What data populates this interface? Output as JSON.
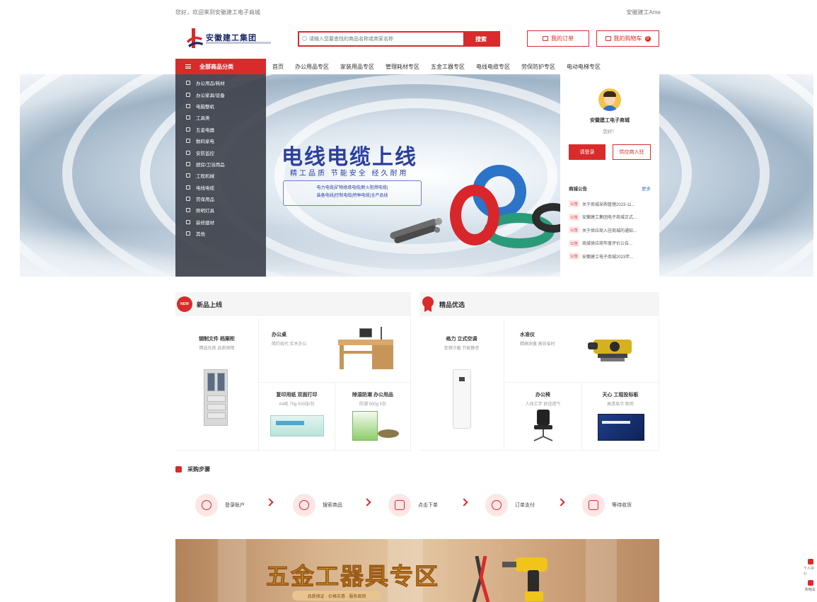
{
  "topbar": {
    "welcome": "您好，欢迎来到安徽建工电子商城",
    "right_link": "安徽建工Ame"
  },
  "brand": {
    "name": "安徽建工集团",
    "logo_icon": "anhui-construction-logo"
  },
  "search": {
    "placeholder": "请输入您要查找的商品名称或商家名称",
    "button_label": "搜索"
  },
  "header_buttons": {
    "order_label": "我的订单",
    "cart_label": "我的购物车",
    "cart_count": "0"
  },
  "nav": {
    "all_categories": "全部商品分类",
    "items": [
      "首页",
      "办公用品专区",
      "家装用品专区",
      "管理耗材专区",
      "五金工器专区",
      "电线电缆专区",
      "劳保防护专区",
      "电动电梯专区"
    ]
  },
  "categories": [
    "办公用品/耗材",
    "办公家具/设备",
    "电脑整机",
    "工具类",
    "五金电器",
    "数码家电",
    "安防监控",
    "厨房/卫浴用品",
    "工程机械",
    "电线电缆",
    "劳保用品",
    "照明灯具",
    "装修建材",
    "其他"
  ],
  "banner": {
    "headline": "电线电缆上线",
    "tagline": "精工品质 节能安全 经久耐用",
    "spec_line_1": "电力电缆|矿物绝缘电缆|耐火阻燃电缆|",
    "spec_line_2": "装备电线|控制电缆|特种电缆|全产品线"
  },
  "user_panel": {
    "site_name": "安徽建工电子商城",
    "greeting": "您好！",
    "login_label": "请登录",
    "join_label": "供应商入驻",
    "notice_title": "商城公告",
    "notice_more": "更多",
    "notices": [
      {
        "tag": "公告",
        "text": "关于商城采购管理2023-11..."
      },
      {
        "tag": "公告",
        "text": "安徽建工集团电子商城正式..."
      },
      {
        "tag": "公告",
        "text": "关于供应商入驻商城的通知..."
      },
      {
        "tag": "公告",
        "text": "商城供应商年度评价公告..."
      },
      {
        "tag": "公告",
        "text": "安徽建工电子商城2023年..."
      }
    ]
  },
  "new_products": {
    "title": "新品上线",
    "badge": "NEW",
    "items": [
      {
        "name": "钢制文件 档案柜",
        "desc": "精选优质 品质保障"
      },
      {
        "name": "办公桌",
        "desc": "简约现代 实木办公"
      },
      {
        "name": "复印用纸 双面打印",
        "desc": "A4纸 70g 500张/包"
      },
      {
        "name": "除湿防潮 办公用品",
        "desc": "防潮 500g 5包"
      }
    ]
  },
  "hot_products": {
    "title": "精品优选",
    "items": [
      {
        "name": "格力 立式空调",
        "desc": "变频冷暖 节能静音"
      },
      {
        "name": "水准仪",
        "desc": "精确测量 高效省时"
      },
      {
        "name": "办公椅",
        "desc": "人体工学 舒适透气"
      },
      {
        "name": "天心 工程投标板",
        "desc": "高清显示 耐用"
      }
    ]
  },
  "steps": {
    "title": "采购步骤",
    "items": [
      "登录账户",
      "搜索商品",
      "点击下单",
      "订单支付",
      "等待收货"
    ]
  },
  "hardware_banner": {
    "title": "五金工器具专区",
    "subtitle": "品质保证 · 价格实惠 · 服务周到"
  },
  "side_float": {
    "personal": "个人中心",
    "cart": "购物车"
  },
  "colors": {
    "brand_red": "#d92b2b",
    "brand_navy": "#1d2a6b",
    "banner_text_blue": "#2a3fa0"
  }
}
